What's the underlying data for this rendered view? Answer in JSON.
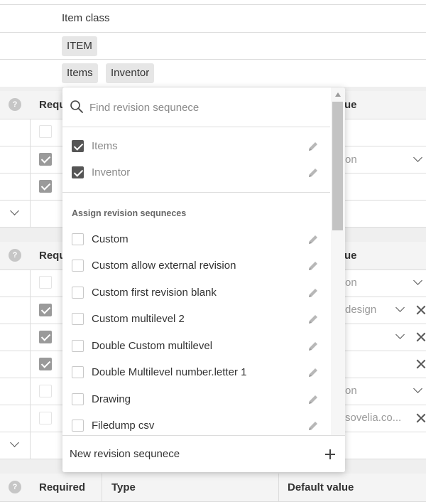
{
  "form": {
    "item_class_label": "Item class",
    "class_chip": "ITEM",
    "selected_chips": [
      "Items",
      "Inventor"
    ]
  },
  "background": {
    "required_partial": "Requ",
    "value_partial": "ue",
    "on_partial": "on",
    "design_partial": "design",
    "email_partial": "sovelia.co...",
    "bottom_headers": [
      "Required",
      "Type",
      "Default value"
    ],
    "help_glyph": "?"
  },
  "dropdown": {
    "search_placeholder": "Find revision sequnece",
    "selected": [
      {
        "label": "Items",
        "checked": true
      },
      {
        "label": "Inventor",
        "checked": true
      }
    ],
    "group_title": "Assign revision sequneces",
    "options": [
      {
        "label": "Custom",
        "checked": false
      },
      {
        "label": "Custom allow external revision",
        "checked": false
      },
      {
        "label": "Custom first revision blank",
        "checked": false
      },
      {
        "label": "Custom multilevel 2",
        "checked": false
      },
      {
        "label": "Double Custom multilevel",
        "checked": false
      },
      {
        "label": "Double Multilevel number.letter 1",
        "checked": false
      },
      {
        "label": "Drawing",
        "checked": false
      },
      {
        "label": "Filedump csv",
        "checked": false
      }
    ],
    "footer_label": "New revision sequnece"
  },
  "icons": {
    "search": "search-icon",
    "edit": "pencil-icon",
    "add": "plus-icon",
    "expand": "chevron-down-icon",
    "clear": "close-icon"
  }
}
